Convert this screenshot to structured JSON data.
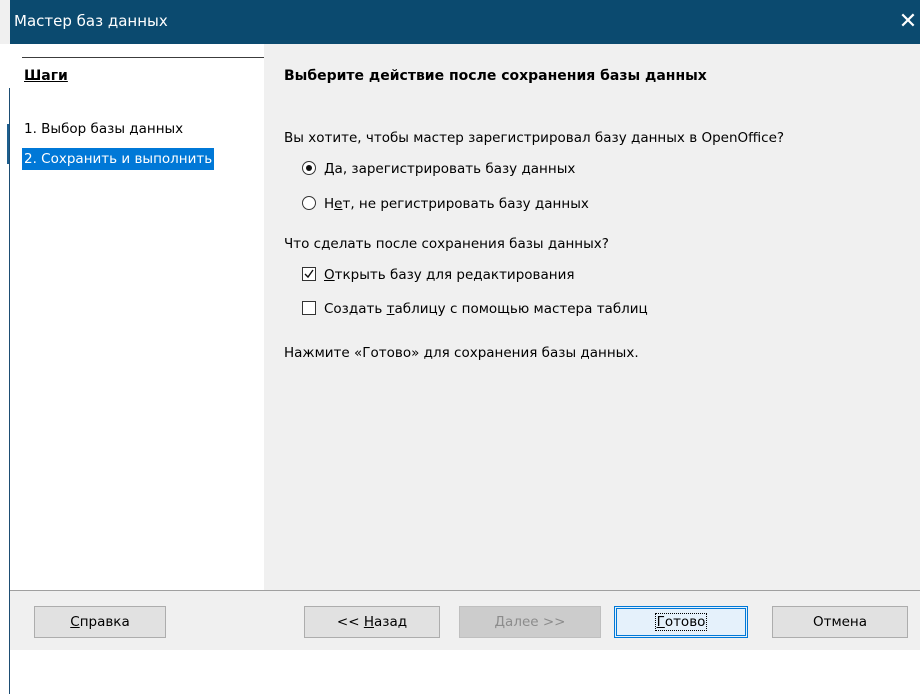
{
  "window": {
    "title": "Мастер баз данных",
    "close_symbol": "✕"
  },
  "steps": {
    "title": "Шаги",
    "items": [
      {
        "label": "1. Выбор базы данных",
        "selected": false
      },
      {
        "label": "2. Сохранить и выполнить",
        "selected": true
      }
    ]
  },
  "content": {
    "heading": "Выберите действие после сохранения базы данных",
    "register_question": "Вы хотите, чтобы мастер зарегистрировал базу данных в OpenOffice?",
    "register_yes": {
      "label_access": "Д",
      "label_rest": "а, зарегистрировать базу данных",
      "checked": true
    },
    "register_no": {
      "label_before": "Н",
      "label_access": "е",
      "label_rest": "т, не регистрировать базу данных",
      "checked": false
    },
    "after_save_question": "Что сделать после сохранения базы данных?",
    "open_for_edit": {
      "label_access": "О",
      "label_rest": "ткрыть базу для редактирования",
      "checked": true
    },
    "create_table": {
      "label_before": "Создать ",
      "label_access": "т",
      "label_rest": "аблицу с помощью мастера таблиц",
      "checked": false
    },
    "finish_hint": "Нажмите «Готово» для сохранения базы данных."
  },
  "buttons": {
    "help": {
      "access": "С",
      "rest": "правка"
    },
    "back": {
      "before": "<< ",
      "access": "Н",
      "rest": "азад"
    },
    "next": {
      "access": "Д",
      "rest": "алее >>"
    },
    "finish": {
      "access": "Г",
      "rest": "отово"
    },
    "cancel": "Отмена"
  },
  "colors": {
    "titlebar": "#0b4a6f",
    "selection": "#0078d7"
  }
}
